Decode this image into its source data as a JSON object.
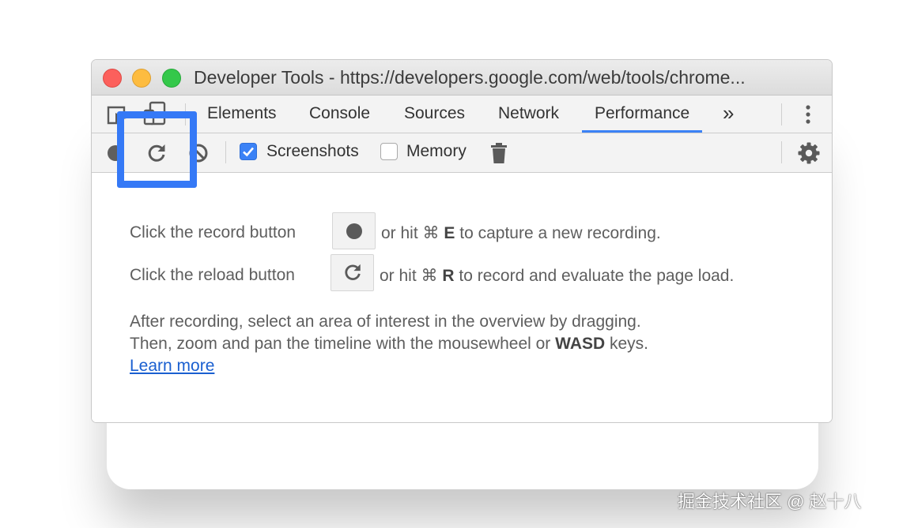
{
  "window": {
    "title": "Developer Tools - https://developers.google.com/web/tools/chrome..."
  },
  "tabs": [
    {
      "label": "Elements"
    },
    {
      "label": "Console"
    },
    {
      "label": "Sources"
    },
    {
      "label": "Network"
    },
    {
      "label": "Performance",
      "active": true
    }
  ],
  "tabbar": {
    "more_tabs_label": "»",
    "icons": [
      "inspect-element-icon",
      "device-toolbar-icon",
      "more-tabs-icon",
      "kebab-menu-icon"
    ]
  },
  "toolbar": {
    "screenshots_label": "Screenshots",
    "screenshots_checked": true,
    "memory_label": "Memory",
    "memory_checked": false,
    "icons": [
      "record-icon",
      "reload-icon",
      "clear-icon",
      "trash-icon",
      "gear-icon"
    ]
  },
  "landing": {
    "record_prefix": "Click the record button",
    "record_mid": "or hit ⌘",
    "record_key": "E",
    "record_suffix": "to capture a new recording.",
    "reload_prefix": "Click the reload button",
    "reload_mid": "or hit ⌘",
    "reload_key": "R",
    "reload_suffix": "to record and evaluate the page load.",
    "after_line1": "After recording, select an area of interest in the overview by dragging.",
    "after_line2_prefix": "Then, zoom and pan the timeline with the mousewheel or",
    "after_line2_keys": "WASD",
    "after_line2_suffix": "keys.",
    "learn_more": "Learn more"
  },
  "colors": {
    "accent": "#3b82f6",
    "highlight": "#3579f6",
    "link": "#1a5fd0"
  },
  "watermark": "掘金技术社区 @ 赵十八"
}
